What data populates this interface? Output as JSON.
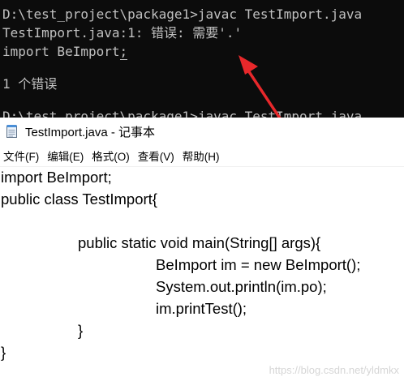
{
  "console": {
    "lines": [
      "D:\\test_project\\package1>javac TestImport.java",
      "TestImport.java:1: 错误: 需要'.'",
      "import BeImport;",
      "",
      "1 个错误",
      "",
      "D:\\test_project\\package1>javac TestImport.java"
    ],
    "line3_prefix": "import BeImport",
    "line3_caret": ";"
  },
  "colors": {
    "console_bg": "#0c0c0c",
    "console_text": "#c0c0c0",
    "arrow": "#e8282b"
  },
  "notepad": {
    "title": "TestImport.java - 记事本",
    "icon": "notepad-icon",
    "menu": [
      "文件(F)",
      "编辑(E)",
      "格式(O)",
      "查看(V)",
      "帮助(H)"
    ],
    "code": [
      "import BeImport;",
      "public class TestImport{",
      "",
      "public static void main(String[] args){",
      "BeImport im = new BeImport();",
      "System.out.println(im.po);",
      "im.printTest();",
      "}",
      "}"
    ]
  },
  "watermark": "https://blog.csdn.net/yldmkx"
}
